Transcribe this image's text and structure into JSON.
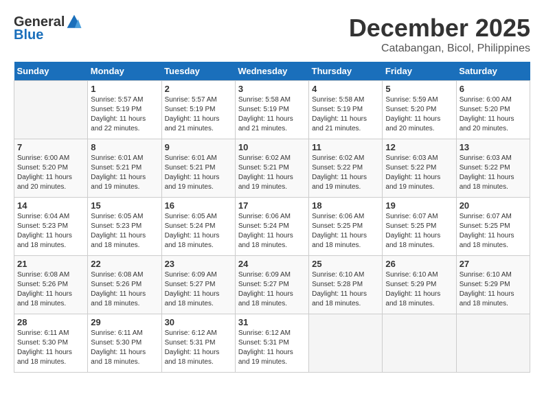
{
  "header": {
    "logo_general": "General",
    "logo_blue": "Blue",
    "month": "December 2025",
    "location": "Catabangan, Bicol, Philippines"
  },
  "weekdays": [
    "Sunday",
    "Monday",
    "Tuesday",
    "Wednesday",
    "Thursday",
    "Friday",
    "Saturday"
  ],
  "weeks": [
    [
      {
        "day": "",
        "sunrise": "",
        "sunset": "",
        "daylight": ""
      },
      {
        "day": "1",
        "sunrise": "Sunrise: 5:57 AM",
        "sunset": "Sunset: 5:19 PM",
        "daylight": "Daylight: 11 hours and 22 minutes."
      },
      {
        "day": "2",
        "sunrise": "Sunrise: 5:57 AM",
        "sunset": "Sunset: 5:19 PM",
        "daylight": "Daylight: 11 hours and 21 minutes."
      },
      {
        "day": "3",
        "sunrise": "Sunrise: 5:58 AM",
        "sunset": "Sunset: 5:19 PM",
        "daylight": "Daylight: 11 hours and 21 minutes."
      },
      {
        "day": "4",
        "sunrise": "Sunrise: 5:58 AM",
        "sunset": "Sunset: 5:19 PM",
        "daylight": "Daylight: 11 hours and 21 minutes."
      },
      {
        "day": "5",
        "sunrise": "Sunrise: 5:59 AM",
        "sunset": "Sunset: 5:20 PM",
        "daylight": "Daylight: 11 hours and 20 minutes."
      },
      {
        "day": "6",
        "sunrise": "Sunrise: 6:00 AM",
        "sunset": "Sunset: 5:20 PM",
        "daylight": "Daylight: 11 hours and 20 minutes."
      }
    ],
    [
      {
        "day": "7",
        "sunrise": "Sunrise: 6:00 AM",
        "sunset": "Sunset: 5:20 PM",
        "daylight": "Daylight: 11 hours and 20 minutes."
      },
      {
        "day": "8",
        "sunrise": "Sunrise: 6:01 AM",
        "sunset": "Sunset: 5:21 PM",
        "daylight": "Daylight: 11 hours and 19 minutes."
      },
      {
        "day": "9",
        "sunrise": "Sunrise: 6:01 AM",
        "sunset": "Sunset: 5:21 PM",
        "daylight": "Daylight: 11 hours and 19 minutes."
      },
      {
        "day": "10",
        "sunrise": "Sunrise: 6:02 AM",
        "sunset": "Sunset: 5:21 PM",
        "daylight": "Daylight: 11 hours and 19 minutes."
      },
      {
        "day": "11",
        "sunrise": "Sunrise: 6:02 AM",
        "sunset": "Sunset: 5:22 PM",
        "daylight": "Daylight: 11 hours and 19 minutes."
      },
      {
        "day": "12",
        "sunrise": "Sunrise: 6:03 AM",
        "sunset": "Sunset: 5:22 PM",
        "daylight": "Daylight: 11 hours and 19 minutes."
      },
      {
        "day": "13",
        "sunrise": "Sunrise: 6:03 AM",
        "sunset": "Sunset: 5:22 PM",
        "daylight": "Daylight: 11 hours and 18 minutes."
      }
    ],
    [
      {
        "day": "14",
        "sunrise": "Sunrise: 6:04 AM",
        "sunset": "Sunset: 5:23 PM",
        "daylight": "Daylight: 11 hours and 18 minutes."
      },
      {
        "day": "15",
        "sunrise": "Sunrise: 6:05 AM",
        "sunset": "Sunset: 5:23 PM",
        "daylight": "Daylight: 11 hours and 18 minutes."
      },
      {
        "day": "16",
        "sunrise": "Sunrise: 6:05 AM",
        "sunset": "Sunset: 5:24 PM",
        "daylight": "Daylight: 11 hours and 18 minutes."
      },
      {
        "day": "17",
        "sunrise": "Sunrise: 6:06 AM",
        "sunset": "Sunset: 5:24 PM",
        "daylight": "Daylight: 11 hours and 18 minutes."
      },
      {
        "day": "18",
        "sunrise": "Sunrise: 6:06 AM",
        "sunset": "Sunset: 5:25 PM",
        "daylight": "Daylight: 11 hours and 18 minutes."
      },
      {
        "day": "19",
        "sunrise": "Sunrise: 6:07 AM",
        "sunset": "Sunset: 5:25 PM",
        "daylight": "Daylight: 11 hours and 18 minutes."
      },
      {
        "day": "20",
        "sunrise": "Sunrise: 6:07 AM",
        "sunset": "Sunset: 5:25 PM",
        "daylight": "Daylight: 11 hours and 18 minutes."
      }
    ],
    [
      {
        "day": "21",
        "sunrise": "Sunrise: 6:08 AM",
        "sunset": "Sunset: 5:26 PM",
        "daylight": "Daylight: 11 hours and 18 minutes."
      },
      {
        "day": "22",
        "sunrise": "Sunrise: 6:08 AM",
        "sunset": "Sunset: 5:26 PM",
        "daylight": "Daylight: 11 hours and 18 minutes."
      },
      {
        "day": "23",
        "sunrise": "Sunrise: 6:09 AM",
        "sunset": "Sunset: 5:27 PM",
        "daylight": "Daylight: 11 hours and 18 minutes."
      },
      {
        "day": "24",
        "sunrise": "Sunrise: 6:09 AM",
        "sunset": "Sunset: 5:27 PM",
        "daylight": "Daylight: 11 hours and 18 minutes."
      },
      {
        "day": "25",
        "sunrise": "Sunrise: 6:10 AM",
        "sunset": "Sunset: 5:28 PM",
        "daylight": "Daylight: 11 hours and 18 minutes."
      },
      {
        "day": "26",
        "sunrise": "Sunrise: 6:10 AM",
        "sunset": "Sunset: 5:29 PM",
        "daylight": "Daylight: 11 hours and 18 minutes."
      },
      {
        "day": "27",
        "sunrise": "Sunrise: 6:10 AM",
        "sunset": "Sunset: 5:29 PM",
        "daylight": "Daylight: 11 hours and 18 minutes."
      }
    ],
    [
      {
        "day": "28",
        "sunrise": "Sunrise: 6:11 AM",
        "sunset": "Sunset: 5:30 PM",
        "daylight": "Daylight: 11 hours and 18 minutes."
      },
      {
        "day": "29",
        "sunrise": "Sunrise: 6:11 AM",
        "sunset": "Sunset: 5:30 PM",
        "daylight": "Daylight: 11 hours and 18 minutes."
      },
      {
        "day": "30",
        "sunrise": "Sunrise: 6:12 AM",
        "sunset": "Sunset: 5:31 PM",
        "daylight": "Daylight: 11 hours and 18 minutes."
      },
      {
        "day": "31",
        "sunrise": "Sunrise: 6:12 AM",
        "sunset": "Sunset: 5:31 PM",
        "daylight": "Daylight: 11 hours and 19 minutes."
      },
      {
        "day": "",
        "sunrise": "",
        "sunset": "",
        "daylight": ""
      },
      {
        "day": "",
        "sunrise": "",
        "sunset": "",
        "daylight": ""
      },
      {
        "day": "",
        "sunrise": "",
        "sunset": "",
        "daylight": ""
      }
    ]
  ]
}
